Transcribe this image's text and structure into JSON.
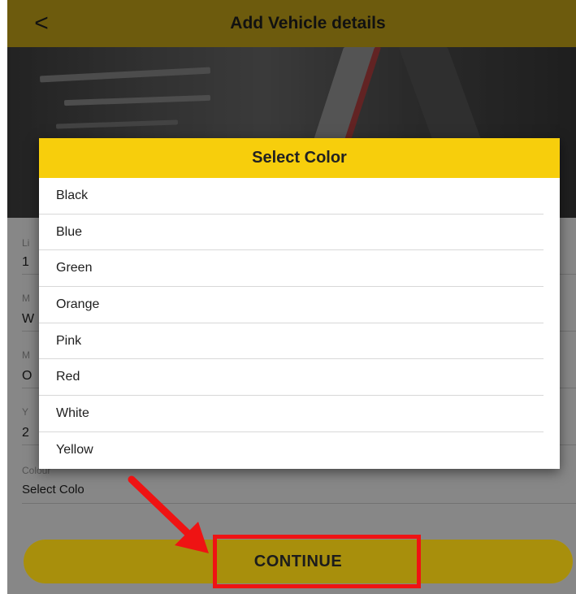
{
  "header": {
    "back_label": "<",
    "title": "Add Vehicle details"
  },
  "form": {
    "fields": [
      {
        "label": "Li",
        "value": "1"
      },
      {
        "label": "M",
        "value": "W"
      },
      {
        "label": "M",
        "value": "O"
      },
      {
        "label": "Y",
        "value": "2"
      }
    ],
    "colour": {
      "label": "Colour",
      "value": "Select Colo"
    }
  },
  "dialog": {
    "title": "Select Color",
    "options": [
      "Black",
      "Blue",
      "Green",
      "Orange",
      "Pink",
      "Red",
      "White",
      "Yellow"
    ]
  },
  "continue": {
    "label": "CONTINUE"
  },
  "colors": {
    "header": "#c6a619",
    "dialog_header": "#f7ce0c",
    "button": "#f1cd12",
    "annotation": "#ef1313"
  },
  "icons": [
    "back-arrow-icon",
    "annotation-arrow-icon"
  ]
}
